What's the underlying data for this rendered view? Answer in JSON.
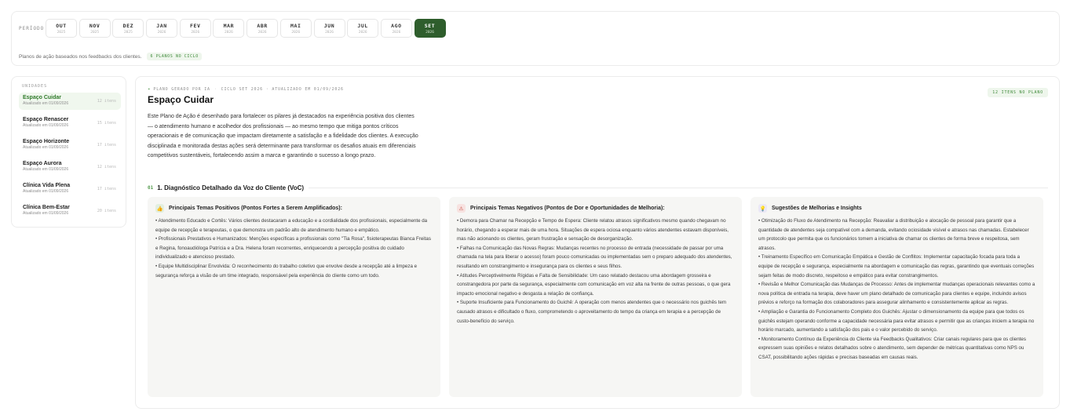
{
  "period": {
    "label": "PERÍODO",
    "months": [
      {
        "m": "OUT",
        "y": "2025",
        "active": false
      },
      {
        "m": "NOV",
        "y": "2025",
        "active": false
      },
      {
        "m": "DEZ",
        "y": "2025",
        "active": false
      },
      {
        "m": "JAN",
        "y": "2026",
        "active": false
      },
      {
        "m": "FEV",
        "y": "2026",
        "active": false
      },
      {
        "m": "MAR",
        "y": "2026",
        "active": false
      },
      {
        "m": "ABR",
        "y": "2026",
        "active": false
      },
      {
        "m": "MAI",
        "y": "2026",
        "active": false
      },
      {
        "m": "JUN",
        "y": "2026",
        "active": false
      },
      {
        "m": "JUL",
        "y": "2026",
        "active": false
      },
      {
        "m": "AGO",
        "y": "2026",
        "active": false
      },
      {
        "m": "SET",
        "y": "2026",
        "active": true
      }
    ],
    "subtitle": "Planos de ação baseados nos feedbacks dos clientes.",
    "plans_badge": "6 PLANOS NO CICLO"
  },
  "units": {
    "label": "UNIDADES",
    "items": [
      {
        "name": "Espaço Cuidar",
        "updated": "Atualizado em 01/09/2026",
        "count": "12 itens",
        "active": true
      },
      {
        "name": "Espaço Renascer",
        "updated": "Atualizado em 01/09/2026",
        "count": "15 itens",
        "active": false
      },
      {
        "name": "Espaço Horizonte",
        "updated": "Atualizado em 01/09/2026",
        "count": "17 itens",
        "active": false
      },
      {
        "name": "Espaço Aurora",
        "updated": "Atualizado em 01/09/2026",
        "count": "12 itens",
        "active": false
      },
      {
        "name": "Clínica Vida Plena",
        "updated": "Atualizado em 01/09/2026",
        "count": "17 itens",
        "active": false
      },
      {
        "name": "Clínica Bem-Estar",
        "updated": "Atualizado em 01/09/2026",
        "count": "20 itens",
        "active": false
      }
    ]
  },
  "plan": {
    "meta_generated": "PLANO GERADO POR IA",
    "meta_cycle": "CICLO SET 2026 · ATUALIZADO EM 01/09/2026",
    "items_badge": "12 ITENS NO PLANO",
    "title": "Espaço Cuidar",
    "intro": "Este Plano de Ação é desenhado para fortalecer os pilares já destacados na experiência positiva dos clientes — o atendimento humano e acolhedor dos profissionais — ao mesmo tempo que mitiga pontos críticos operacionais e de comunicação que impactam diretamente a satisfação e a fidelidade dos clientes. A execução disciplinada e monitorada destas ações será determinante para transformar os desafios atuais em diferenciais competitivos sustentáveis, fortalecendo assim a marca e garantindo o sucesso a longo prazo.",
    "section_num": "01",
    "section_title": "1. Diagnóstico Detalhado da Voz do Cliente (VoC)",
    "columns": [
      {
        "icon": "thumbs-up-icon",
        "title": "Principais Temas Positivos (Pontos Fortes a Serem Amplificados):",
        "paragraphs": [
          "• Atendimento Educado e Cortês: Vários clientes destacaram a educação e a cordialidade dos profissionais, especialmente da equipe de recepção e terapeutas, o que demonstra um padrão alto de atendimento humano e empático.",
          "• Profissionais Prestativos e Humanizados: Menções específicas a profissionais como \"Tia Rosa\", fisioterapeutas Bianca Freitas e Regina, fonoaudióloga Patrícia e a Dra. Helena foram recorrentes, enriquecendo a percepção positiva do cuidado individualizado e atencioso prestado.",
          "• Equipe Multidisciplinar Envolvida: O reconhecimento do trabalho coletivo que envolve desde a recepção até a limpeza e segurança reforça a visão de um time integrado, responsável pela experiência do cliente como um todo."
        ]
      },
      {
        "icon": "alert-icon",
        "title": "Principais Temas Negativos (Pontos de Dor e Oportunidades de Melhoria):",
        "paragraphs": [
          "• Demora para Chamar na Recepção e Tempo de Espera: Cliente relatou atrasos significativos mesmo quando chegavam no horário, chegando a esperar mais de uma hora. Situações de espera ociosa enquanto vários atendentes estavam disponíveis, mas não acionando os clientes, geram frustração e sensação de desorganização.",
          "• Falhas na Comunicação das Novas Regras: Mudanças recentes no processo de entrada (necessidade de passar por uma chamada na tela para liberar o acesso) foram pouco comunicadas ou implementadas sem o preparo adequado dos atendentes, resultando em constrangimento e insegurança para os clientes e seus filhos.",
          "• Atitudes Perceptivelmente Rígidas e Falta de Sensibilidade: Um caso relatado destacou uma abordagem grosseira e constrangedora por parte da segurança, especialmente com comunicação em voz alta na frente de outras pessoas, o que gera impacto emocional negativo e desgasta a relação de confiança.",
          "• Suporte Insuficiente para Funcionamento do Guichê: A operação com menos atendentes que o necessário nos guichês tem causado atrasos e dificultado o fluxo, comprometendo o aproveitamento do tempo da criança em terapia e a percepção de custo-benefício do serviço."
        ]
      },
      {
        "icon": "lightbulb-icon",
        "title": "Sugestões de Melhorias e Insights",
        "paragraphs": [
          "• Otimização do Fluxo de Atendimento na Recepção: Reavaliar a distribuição e alocação de pessoal para garantir que a quantidade de atendentes seja compatível com a demanda, evitando ociosidade visível e atrasos nas chamadas. Estabelecer um protocolo que permita que os funcionários tomem a iniciativa de chamar os clientes de forma breve e respeitosa, sem atrasos.",
          "• Treinamento Específico em Comunicação Empática e Gestão de Conflitos: Implementar capacitação focada para toda a equipe de recepção e segurança, especialmente na abordagem e comunicação das regras, garantindo que eventuais correções sejam feitas de modo discreto, respeitoso e empático para evitar constrangimentos.",
          "• Revisão e Melhor Comunicação das Mudanças de Processo: Antes de implementar mudanças operacionais relevantes como a nova política de entrada na terapia, deve haver um plano detalhado de comunicação para clientes e equipe, incluindo avisos prévios e reforço na formação dos colaboradores para assegurar alinhamento e consistentemente aplicar as regras.",
          "• Ampliação e Garantia do Funcionamento Completo dos Guichês: Ajustar o dimensionamento da equipe para que todos os guichês estejam operando conforme a capacidade necessária para evitar atrasos e permitir que as crianças iniciem a terapia no horário marcado, aumentando a satisfação dos pais e o valor percebido do serviço.",
          "• Monitoramento Contínuo da Experiência do Cliente via Feedbacks Qualitativos: Criar canais regulares para que os clientes expressem suas opiniões e relatos detalhados sobre o atendimento, sem depender de métricas quantitativas como NPS ou CSAT, possibilitando ações rápidas e precisas baseadas em causas reais."
        ]
      }
    ]
  }
}
